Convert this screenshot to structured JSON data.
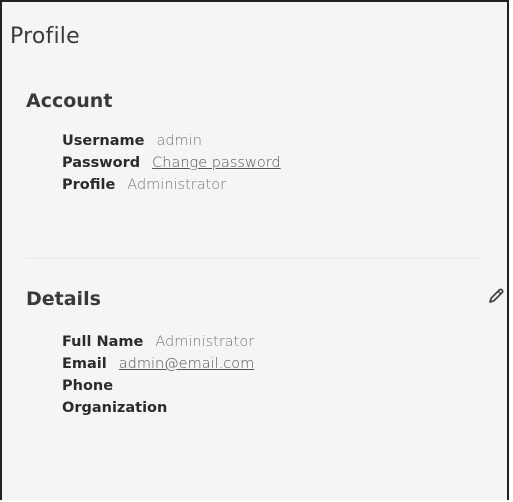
{
  "page": {
    "title": "Profile"
  },
  "account": {
    "title": "Account",
    "fields": [
      {
        "label": "Username",
        "value": "admin"
      },
      {
        "label": "Password",
        "link": "Change password"
      },
      {
        "label": "Profile",
        "value": "Administrator"
      }
    ]
  },
  "details": {
    "title": "Details",
    "edit_icon": "pencil-icon",
    "fields": [
      {
        "label": "Full Name",
        "value": "Administrator"
      },
      {
        "label": "Email",
        "link": "admin@email.com"
      },
      {
        "label": "Phone",
        "value": ""
      },
      {
        "label": "Organization",
        "value": ""
      }
    ]
  },
  "colors": {
    "background": "#f5f5f5",
    "border": "#222222",
    "text": "#333333"
  }
}
